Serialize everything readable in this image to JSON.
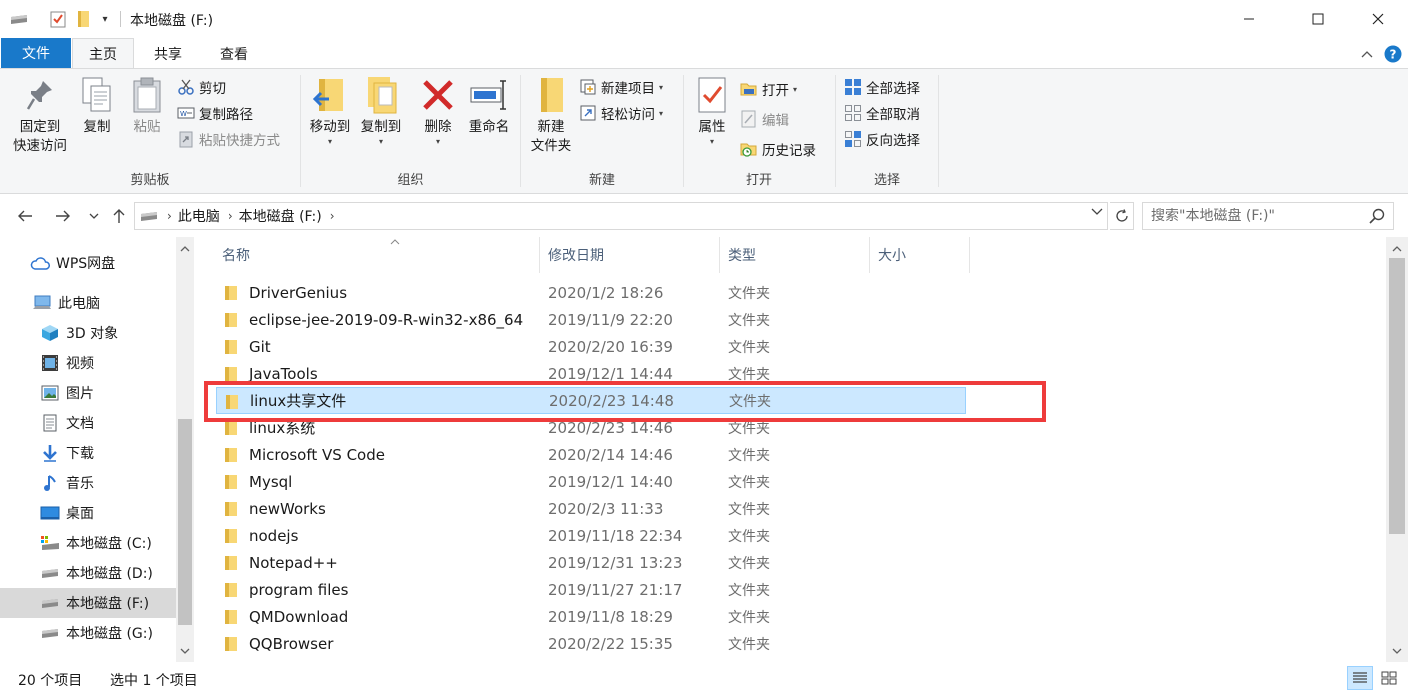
{
  "window": {
    "title": "本地磁盘 (F:)"
  },
  "ribbon_tabs": {
    "file": "文件",
    "home": "主页",
    "share": "共享",
    "view": "查看"
  },
  "ribbon": {
    "clipboard": {
      "label": "剪贴板",
      "pin_line1": "固定到",
      "pin_line2": "快速访问",
      "copy": "复制",
      "paste": "粘贴",
      "cut": "剪切",
      "copy_path": "复制路径",
      "paste_shortcut": "粘贴快捷方式"
    },
    "organize": {
      "label": "组织",
      "move_to": "移动到",
      "copy_to": "复制到",
      "delete": "删除",
      "rename": "重命名"
    },
    "new": {
      "label": "新建",
      "new_folder_line1": "新建",
      "new_folder_line2": "文件夹",
      "new_item": "新建项目",
      "easy_access": "轻松访问"
    },
    "open": {
      "label": "打开",
      "properties": "属性",
      "open": "打开",
      "edit": "编辑",
      "history": "历史记录"
    },
    "select": {
      "label": "选择",
      "select_all": "全部选择",
      "select_none": "全部取消",
      "invert": "反向选择"
    }
  },
  "address": {
    "crumbs": [
      "此电脑",
      "本地磁盘 (F:)"
    ],
    "search_placeholder": "搜索\"本地磁盘 (F:)\""
  },
  "nav_pane": {
    "items": [
      {
        "label": "WPS网盘",
        "icon": "cloud-icon"
      },
      {
        "label": "此电脑",
        "icon": "computer-icon"
      },
      {
        "label": "3D 对象",
        "icon": "cube-icon"
      },
      {
        "label": "视频",
        "icon": "video-icon"
      },
      {
        "label": "图片",
        "icon": "picture-icon"
      },
      {
        "label": "文档",
        "icon": "document-icon"
      },
      {
        "label": "下载",
        "icon": "download-icon"
      },
      {
        "label": "音乐",
        "icon": "music-icon"
      },
      {
        "label": "桌面",
        "icon": "desktop-icon"
      },
      {
        "label": "本地磁盘 (C:)",
        "icon": "drive-icon"
      },
      {
        "label": "本地磁盘 (D:)",
        "icon": "drive-icon"
      },
      {
        "label": "本地磁盘 (F:)",
        "icon": "drive-icon"
      },
      {
        "label": "本地磁盘 (G:)",
        "icon": "drive-icon"
      }
    ]
  },
  "columns": {
    "name": "名称",
    "modified": "修改日期",
    "type": "类型",
    "size": "大小"
  },
  "files": [
    {
      "name": "DriverGenius",
      "date": "2020/1/2 18:26",
      "type": "文件夹"
    },
    {
      "name": "eclipse-jee-2019-09-R-win32-x86_64",
      "date": "2019/11/9 22:20",
      "type": "文件夹"
    },
    {
      "name": "Git",
      "date": "2020/2/20 16:39",
      "type": "文件夹"
    },
    {
      "name": "JavaTools",
      "date": "2019/12/1 14:44",
      "type": "文件夹"
    },
    {
      "name": "linux共享文件",
      "date": "2020/2/23 14:48",
      "type": "文件夹"
    },
    {
      "name": "linux系统",
      "date": "2020/2/23 14:46",
      "type": "文件夹"
    },
    {
      "name": "Microsoft VS Code",
      "date": "2020/2/14 14:46",
      "type": "文件夹"
    },
    {
      "name": "Mysql",
      "date": "2019/12/1 14:40",
      "type": "文件夹"
    },
    {
      "name": "newWorks",
      "date": "2020/2/3 11:33",
      "type": "文件夹"
    },
    {
      "name": "nodejs",
      "date": "2019/11/18 22:34",
      "type": "文件夹"
    },
    {
      "name": "Notepad++",
      "date": "2019/12/31 13:23",
      "type": "文件夹"
    },
    {
      "name": "program files",
      "date": "2019/11/27 21:17",
      "type": "文件夹"
    },
    {
      "name": "QMDownload",
      "date": "2019/11/8 18:29",
      "type": "文件夹"
    },
    {
      "name": "QQBrowser",
      "date": "2020/2/22 15:35",
      "type": "文件夹"
    }
  ],
  "status": {
    "item_count": "20 个项目",
    "selected_count": "选中 1 个项目"
  },
  "colors": {
    "accent": "#1979ca",
    "selection": "#cce8ff",
    "folder": "#f8d775",
    "highlight": "#ee3b3b"
  }
}
